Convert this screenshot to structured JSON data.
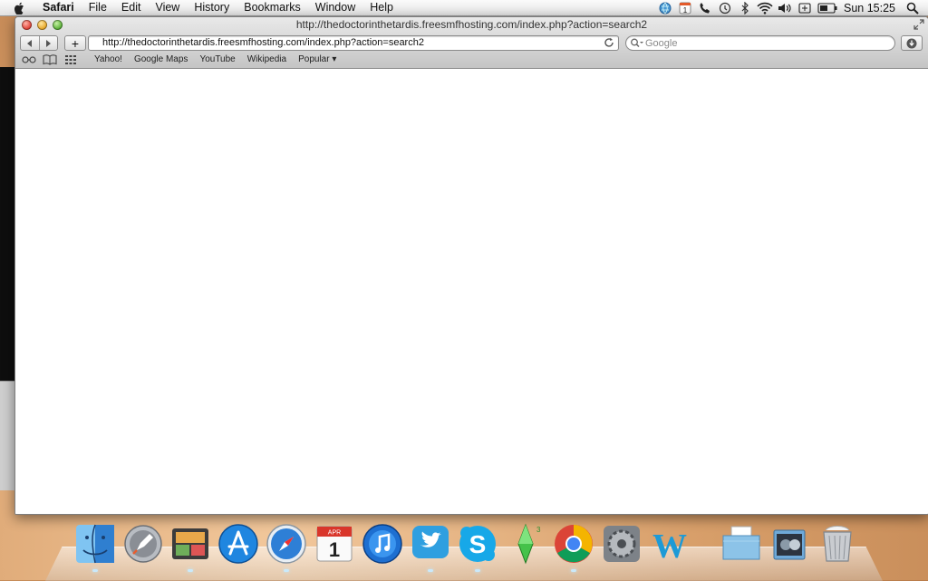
{
  "menubar": {
    "app": "Safari",
    "items": [
      "File",
      "Edit",
      "View",
      "History",
      "Bookmarks",
      "Window",
      "Help"
    ],
    "status_icons": [
      "status-globe-icon",
      "calendar-badge-icon",
      "phone-icon",
      "time-machine-icon",
      "bluetooth-icon",
      "wifi-icon",
      "volume-icon",
      "keyboard-icon",
      "battery-icon"
    ],
    "calendar_badge": "1",
    "clock": "Sun 15:25"
  },
  "window": {
    "title": "http://thedoctorinthetardis.freesmfhosting.com/index.php?action=search2",
    "url": "http://thedoctorinthetardis.freesmfhosting.com/index.php?action=search2",
    "search_placeholder": "Google",
    "add_bookmark_label": "+",
    "bookmarks": [
      "Yahoo!",
      "Google Maps",
      "YouTube",
      "Wikipedia",
      "Popular ▾"
    ]
  },
  "dock": {
    "apps": [
      "finder",
      "launchpad",
      "photo-booth",
      "app-store",
      "safari",
      "calendar",
      "itunes",
      "twitter",
      "skype",
      "the-sims-3",
      "chrome",
      "system-preferences",
      "wordpress",
      "documents-stack",
      "downloads-stack",
      "trash"
    ],
    "calendar_month": "APR",
    "calendar_day": "1",
    "sims_badge": "3",
    "colors": {
      "safari_blue": "#2e7fd6",
      "skype_blue": "#17a8e8",
      "twitter_blue": "#2f9fe0"
    }
  }
}
